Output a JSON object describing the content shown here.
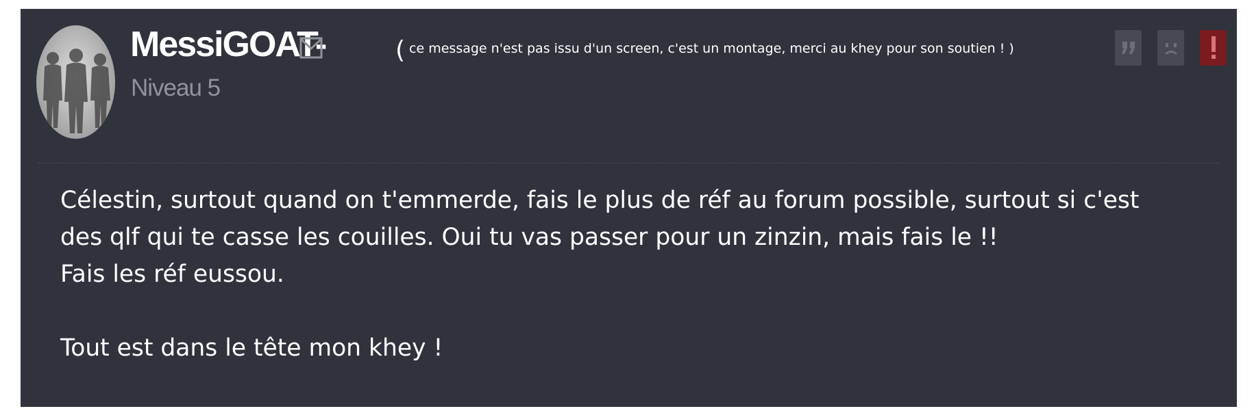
{
  "post": {
    "author": "MessiGOAT-",
    "level": "Niveau 5",
    "note_open": "(",
    "note_text": "ce message n'est pas issu d'un screen, c'est un montage, merci au khey pour son soutien ! )",
    "body": {
      "line1": "Célestin, surtout quand on t'emmerde, fais le plus de réf au forum possible, surtout si c'est",
      "line2": "des qlf qui te casse les couilles. Oui tu vas passer pour un zinzin, mais fais le !!",
      "line3": "Fais les réf eussou.",
      "line4": "Tout est dans le tête mon khey !"
    },
    "actions": {
      "quote_icon": "quote-icon",
      "sad_icon": "sad-face-icon",
      "alert_icon": "exclamation-icon"
    },
    "colors": {
      "background": "#30333b",
      "alert": "#7a1b20",
      "button": "#464a52",
      "level_text": "#8f939a"
    }
  }
}
